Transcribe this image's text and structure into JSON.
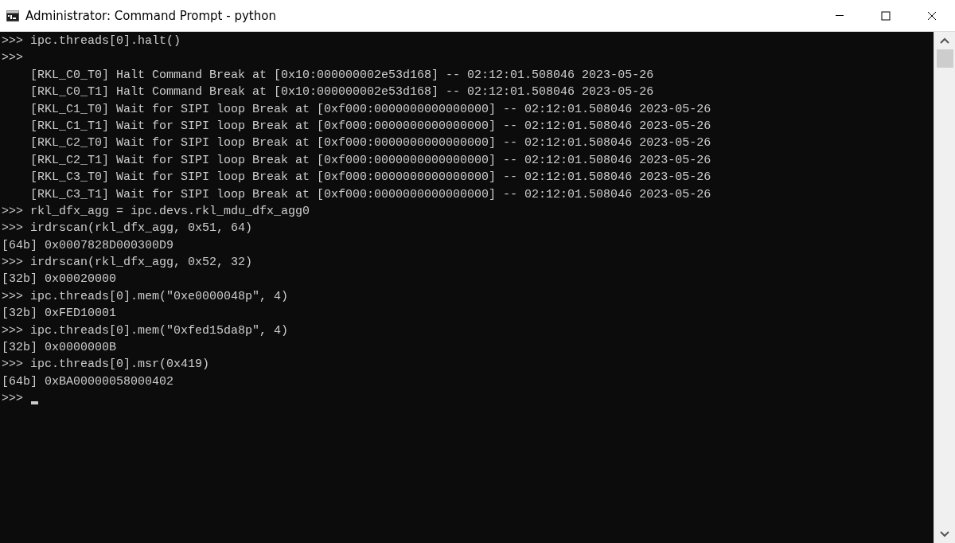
{
  "window": {
    "title": "Administrator: Command Prompt - python"
  },
  "console": {
    "lines": [
      ">>> ipc.threads[0].halt()",
      ">>>",
      "    [RKL_C0_T0] Halt Command Break at [0x10:000000002e53d168] -- 02:12:01.508046 2023-05-26",
      "    [RKL_C0_T1] Halt Command Break at [0x10:000000002e53d168] -- 02:12:01.508046 2023-05-26",
      "    [RKL_C1_T0] Wait for SIPI loop Break at [0xf000:0000000000000000] -- 02:12:01.508046 2023-05-26",
      "    [RKL_C1_T1] Wait for SIPI loop Break at [0xf000:0000000000000000] -- 02:12:01.508046 2023-05-26",
      "    [RKL_C2_T0] Wait for SIPI loop Break at [0xf000:0000000000000000] -- 02:12:01.508046 2023-05-26",
      "    [RKL_C2_T1] Wait for SIPI loop Break at [0xf000:0000000000000000] -- 02:12:01.508046 2023-05-26",
      "    [RKL_C3_T0] Wait for SIPI loop Break at [0xf000:0000000000000000] -- 02:12:01.508046 2023-05-26",
      "    [RKL_C3_T1] Wait for SIPI loop Break at [0xf000:0000000000000000] -- 02:12:01.508046 2023-05-26",
      ">>> rkl_dfx_agg = ipc.devs.rkl_mdu_dfx_agg0",
      ">>> irdrscan(rkl_dfx_agg, 0x51, 64)",
      "[64b] 0x0007828D000300D9",
      ">>> irdrscan(rkl_dfx_agg, 0x52, 32)",
      "[32b] 0x00020000",
      ">>> ipc.threads[0].mem(\"0xe0000048p\", 4)",
      "[32b] 0xFED10001",
      ">>> ipc.threads[0].mem(\"0xfed15da8p\", 4)",
      "[32b] 0x0000000B",
      ">>> ipc.threads[0].msr(0x419)",
      "[64b] 0xBA00000058000402",
      ">>>"
    ]
  }
}
